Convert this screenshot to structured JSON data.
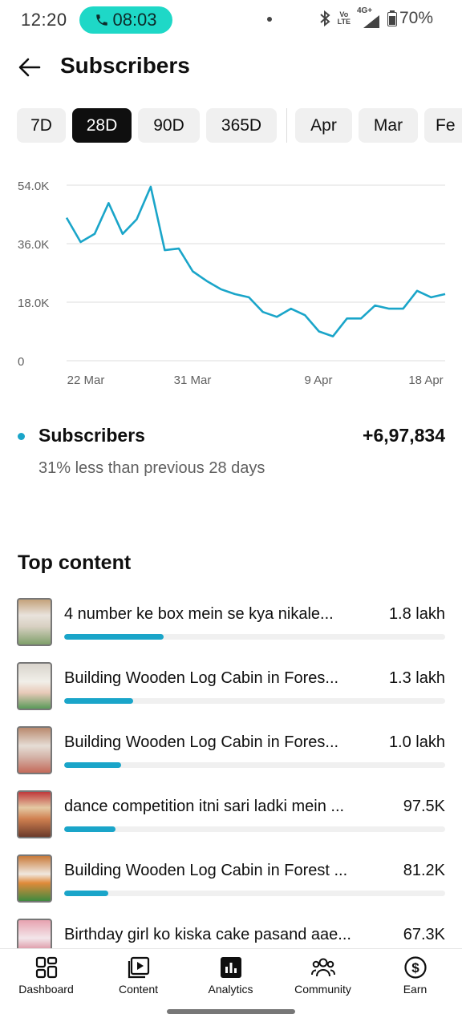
{
  "status_bar": {
    "time": "12:20",
    "call_timer": "08:03",
    "volte_top": "Vo",
    "volte_bottom": "LTE",
    "network": "4G+",
    "battery": "70%",
    "accent_color": "#1ed8c7"
  },
  "app_bar": {
    "title": "Subscribers",
    "back_icon": "arrow-left-icon"
  },
  "range_chips": {
    "items": [
      "7D",
      "28D",
      "90D",
      "365D",
      "Apr",
      "Mar",
      "Fe"
    ],
    "selected": "28D"
  },
  "chart_data": {
    "type": "line",
    "title": "",
    "xlabel": "",
    "ylabel": "",
    "y_tick_labels": [
      "0",
      "18.0K",
      "36.0K",
      "54.0K"
    ],
    "y_ticks": [
      0,
      18000,
      36000,
      54000
    ],
    "x_tick_labels": [
      "22 Mar",
      "31 Mar",
      "9 Apr",
      "18 Apr"
    ],
    "ylim": [
      0,
      54000
    ],
    "grid": true,
    "line_color": "#1aa5c9",
    "series": [
      {
        "name": "Subscribers",
        "values": [
          44000,
          36500,
          39000,
          48500,
          39000,
          43500,
          53500,
          34000,
          34500,
          27500,
          24500,
          22000,
          20500,
          19500,
          15000,
          13500,
          16000,
          14000,
          9000,
          7500,
          13000,
          13000,
          17000,
          16000,
          16000,
          21500,
          19500,
          20500
        ]
      }
    ]
  },
  "summary": {
    "label": "Subscribers",
    "value": "+6,97,834",
    "comparison": "31% less than previous 28 days",
    "dot_color": "#1aa5c9"
  },
  "top_content": {
    "title": "Top content",
    "items": [
      {
        "title": "4 number ke box mein se kya nikale...",
        "value": "1.8 lakh",
        "share": 0.26
      },
      {
        "title": "Building Wooden Log Cabin in Fores...",
        "value": "1.3 lakh",
        "share": 0.18
      },
      {
        "title": "Building Wooden Log Cabin in Fores...",
        "value": "1.0 lakh",
        "share": 0.15
      },
      {
        "title": "dance competition itni sari ladki mein ...",
        "value": "97.5K",
        "share": 0.135
      },
      {
        "title": "Building Wooden Log Cabin in Forest ...",
        "value": "81.2K",
        "share": 0.115
      },
      {
        "title": "Birthday girl ko kiska cake pasand aae...",
        "value": "67.3K",
        "share": 0.09
      }
    ]
  },
  "bottom_nav": {
    "items": [
      {
        "label": "Dashboard",
        "icon": "dashboard-icon"
      },
      {
        "label": "Content",
        "icon": "content-icon"
      },
      {
        "label": "Analytics",
        "icon": "analytics-icon",
        "active": true
      },
      {
        "label": "Community",
        "icon": "community-icon"
      },
      {
        "label": "Earn",
        "icon": "earn-icon"
      }
    ]
  }
}
